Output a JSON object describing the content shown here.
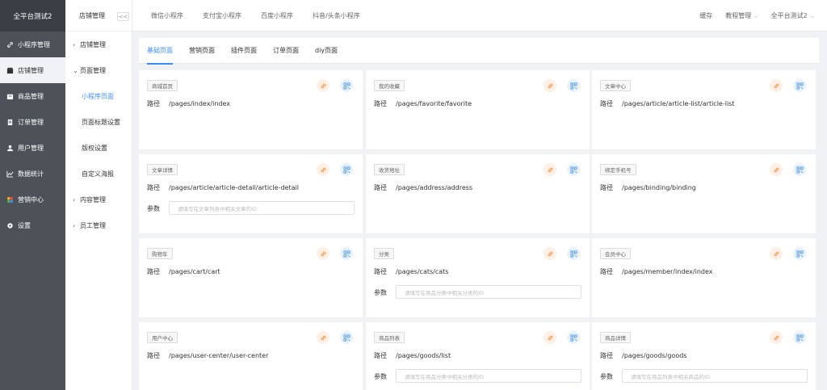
{
  "brand": "全平台测试2",
  "sidebar": {
    "items": [
      {
        "label": "小程序管理",
        "icon": "link-icon"
      },
      {
        "label": "店铺管理",
        "icon": "shop-icon",
        "active": true
      },
      {
        "label": "商品管理",
        "icon": "goods-icon"
      },
      {
        "label": "订单管理",
        "icon": "order-icon"
      },
      {
        "label": "用户管理",
        "icon": "user-icon"
      },
      {
        "label": "数据统计",
        "icon": "chart-icon"
      },
      {
        "label": "营销中心",
        "icon": "marketing-icon"
      },
      {
        "label": "设置",
        "icon": "settings-icon"
      }
    ]
  },
  "subnav": {
    "title": "店铺管理",
    "collapse": "<<",
    "groups": [
      {
        "label": "店铺管理",
        "chev": "›"
      },
      {
        "label": "页面管理",
        "chev": "⌄"
      },
      {
        "label": "内容管理",
        "chev": "›"
      },
      {
        "label": "员工管理",
        "chev": "›"
      }
    ],
    "children": [
      "小程序页面",
      "页面标题设置",
      "版权设置",
      "自定义海报"
    ]
  },
  "topbar": {
    "tabs": [
      "微信小程序",
      "支付宝小程序",
      "百度小程序",
      "抖音/头条小程序"
    ],
    "cache": "缓存",
    "tutorial": "教程管理",
    "account": "全平台测试2"
  },
  "page_tabs": [
    "基础页面",
    "营销页面",
    "插件页面",
    "订单页面",
    "diy页面"
  ],
  "labels": {
    "path": "路径",
    "param": "参数"
  },
  "cards": [
    {
      "tag": "商城首页",
      "path": "/pages/index/index"
    },
    {
      "tag": "我的收藏",
      "path": "/pages/favorite/favorite"
    },
    {
      "tag": "文章中心",
      "path": "/pages/article/article-list/article-list"
    },
    {
      "tag": "文章详情",
      "path": "/pages/article/article-detail/article-detail",
      "placeholder": "请填写在文章列表中相关文章的ID"
    },
    {
      "tag": "收货地址",
      "path": "/pages/address/address"
    },
    {
      "tag": "绑定手机号",
      "path": "/pages/binding/binding"
    },
    {
      "tag": "购物车",
      "path": "/pages/cart/cart"
    },
    {
      "tag": "分类",
      "path": "/pages/cats/cats",
      "placeholder": "请填写在商品分类中相关分类的ID"
    },
    {
      "tag": "会员中心",
      "path": "/pages/member/index/index"
    },
    {
      "tag": "用户中心",
      "path": "/pages/user-center/user-center"
    },
    {
      "tag": "商品列表",
      "path": "/pages/goods/list",
      "placeholder": "请填写在商品分类中相关分类的ID"
    },
    {
      "tag": "商品详情",
      "path": "/pages/goods/goods",
      "placeholder": "请填写在商品列表中相关商品的ID"
    }
  ],
  "colors": {
    "accent": "#3e8ef7",
    "link_icon": "#f5a05a",
    "qr_icon": "#3e8ef7",
    "sidebar": "#4d5259"
  }
}
